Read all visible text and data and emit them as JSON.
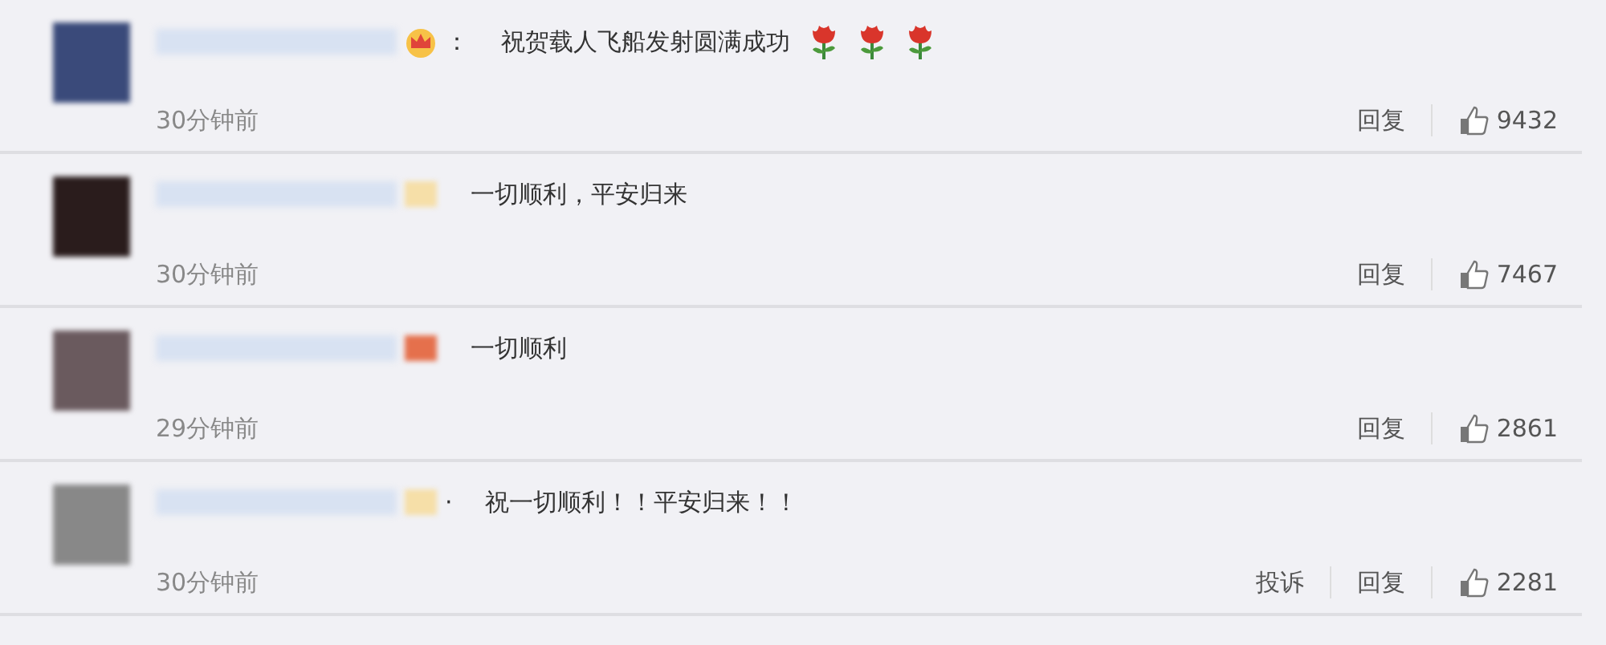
{
  "comments": [
    {
      "badge": {
        "kind": "crown"
      },
      "separator": "：",
      "text": "祝贺载人飞船发射圆满成功",
      "trailing_icons": [
        {
          "kind": "rose"
        },
        {
          "kind": "rose"
        },
        {
          "kind": "rose"
        }
      ],
      "time": "30分钟前",
      "actions": [
        "回复"
      ],
      "likes": "9432"
    },
    {
      "badge": {
        "kind": "gold"
      },
      "text": "一切顺利，平安归来",
      "time": "30分钟前",
      "actions": [
        "回复"
      ],
      "likes": "7467"
    },
    {
      "badge": {
        "kind": "red"
      },
      "text": "一切顺利",
      "time": "29分钟前",
      "actions": [
        "回复"
      ],
      "likes": "2861"
    },
    {
      "badge": {
        "kind": "gold"
      },
      "separator": "·",
      "text": "祝一切顺利！！平安归来！！",
      "time": "30分钟前",
      "actions": [
        "投诉",
        "回复"
      ],
      "likes": "2281"
    }
  ]
}
